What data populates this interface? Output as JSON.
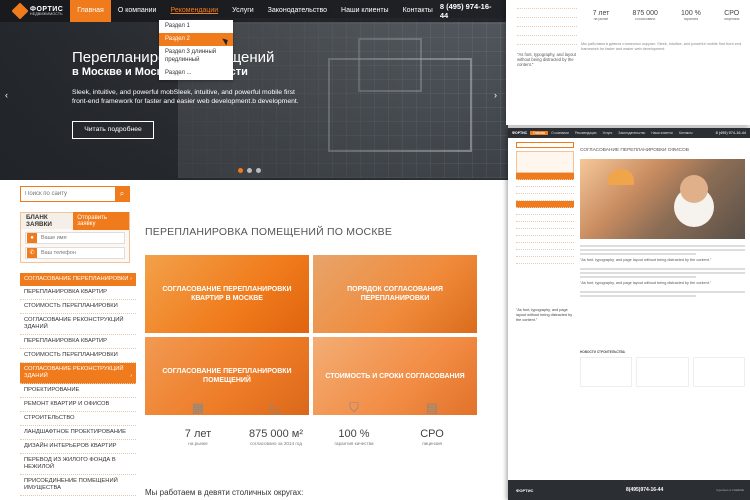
{
  "nav": {
    "logo_name": "ФОРТИС",
    "logo_sub": "НЕДВИЖИМОСТЬ",
    "items": [
      "Главная",
      "О компании",
      "Рекомендации",
      "Услуги",
      "Законодательство",
      "Наши клиенты",
      "Контакты"
    ],
    "phone": "8 (495) 974-16-44"
  },
  "dropdown": {
    "items": [
      "Раздел 1",
      "Раздел 2",
      "Раздел 3 длинный предлинный",
      "Раздел ..."
    ]
  },
  "hero": {
    "title": "Перепланировка помещений",
    "subtitle": "в Москве и Московской области",
    "text": "Sleek, intuitive, and powerful mobSleek, intuitive, and powerful mobile first front-end framework for faster and easier web development.b development.",
    "button": "Читать подробнее",
    "arrow_left": "‹",
    "arrow_right": "›"
  },
  "sidebar": {
    "search_placeholder": "Поиск по сайту",
    "request_title": "БЛАНК ЗАЯВКИ",
    "request_send": "Отправить заявку",
    "name_placeholder": "Ваше имя",
    "phone_placeholder": "Ваш телефон",
    "menu": [
      "СОГЛАСОВАНИЕ ПЕРЕПЛАНИРОВКИ",
      "ПЕРЕПЛАНИРОВКА КВАРТИР",
      "СТОИМОСТЬ ПЕРЕПЛАНИРОВКИ",
      "СОГЛАСОВАНИЕ РЕКОНСТРУКЦИЙ ЗДАНИЙ",
      "ПЕРЕПЛАНИРОВКА КВАРТИР",
      "СТОИМОСТЬ ПЕРЕПЛАНИРОВКИ",
      "СОГЛАСОВАНИЕ РЕКОНСТРУКЦИЙ ЗДАНИЙ",
      "ПРОЕКТИРОВАНИЕ",
      "РЕМОНТ КВАРТИР И ОФИСОВ",
      "СТРОИТЕЛЬСТВО",
      "ЛАНДШАФТНОЕ ПРОЕКТИРОВАНИЕ",
      "ДИЗАЙН ИНТЕРЬЕРОВ КВАРТИР",
      "ПЕРЕВОД ИЗ ЖИЛОГО ФОНДА В НЕЖИЛОЙ",
      "ПРИСОЕДИНЕНИЕ ПОМЕЩЕНИЙ ИМУЩЕСТВА"
    ]
  },
  "content": {
    "title": "ПЕРЕПЛАНИРОВКА ПОМЕЩЕНИЙ ПО МОСКВЕ",
    "tiles": [
      "СОГЛАСОВАНИЕ ПЕРЕПЛАНИРОВКИ КВАРТИР В МОСКВЕ",
      "ПОРЯДОК СОГЛАСОВАНИЯ ПЕРЕПЛАНИРОВКИ",
      "СОГЛАСОВАНИЕ ПЕРЕПЛАНИРОВКИ ПОМЕЩЕНИЙ",
      "СТОИМОСТЬ И СРОКИ СОГЛАСОВАНИЯ"
    ],
    "stats": [
      {
        "value": "7 лет",
        "caption": "на рынке",
        "icon": "calendar-icon"
      },
      {
        "value": "875 000 м²",
        "caption": "согласовано за 2014 год",
        "icon": "ruler-icon"
      },
      {
        "value": "100 %",
        "caption": "гарантия качества",
        "icon": "shield-icon"
      },
      {
        "value": "СРО",
        "caption": "лицензия",
        "icon": "certificate-icon"
      }
    ],
    "bottom_text": "Мы работаем в девяти столичных округах:"
  },
  "collage": {
    "r1_stats": [
      {
        "value": "7 лет",
        "caption": "на рынке"
      },
      {
        "value": "875 000",
        "caption": "согласовано"
      },
      {
        "value": "100 %",
        "caption": "гарантия"
      },
      {
        "value": "СРО",
        "caption": "лицензия"
      }
    ],
    "r1_quote": "\"As font, typography, and layout without being distracted by the content.\"",
    "r1_text": "Мы работаем в девяти столичных округах: Sleek, intuitive, and powerful mobile first front-end framework for faster and easier web development.",
    "r2_nav": [
      "Главная",
      "О компании",
      "Рекомендации",
      "Услуги",
      "Законодательство",
      "Наши клиенты",
      "Контакты"
    ],
    "r2_phone": "8 (495) 974-16-44",
    "r2_title": "СОГЛАСОВАНИЕ ПЕРЕПЛАНИРОВКИ ОФИСОВ",
    "r2_quote1": "\"As font, typography, and page layout without being distracted by the content.\"",
    "r2_quote2": "\"As font, typography, and page layout without being distracted by the content.\"",
    "r2_lquote": "\"As font, typography, and page layout without being distracted by the content.\"",
    "r2_news_title": "НОВОСТИ СТРОИТЕЛЬСТВА",
    "r2_foot_logo": "ФОРТИС",
    "r2_foot_phone": "8(495)974-16-44",
    "r2_foot_by": "Сделано в CHEESE"
  }
}
